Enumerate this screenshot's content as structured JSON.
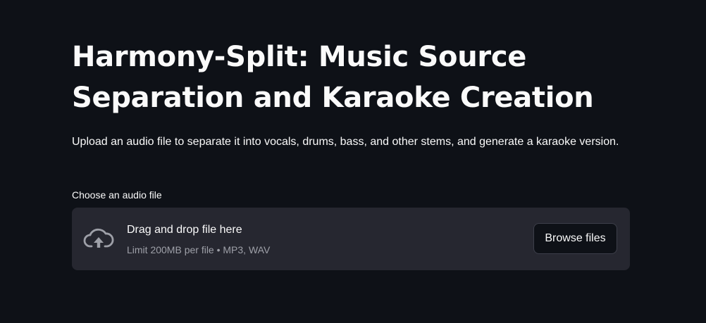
{
  "page": {
    "title": "Harmony-Split: Music Source Separation and Karaoke Creation",
    "description": "Upload an audio file to separate it into vocals, drums, bass, and other stems, and generate a karaoke version."
  },
  "uploader": {
    "label": "Choose an audio file",
    "instruction": "Drag and drop file here",
    "limit_text": "Limit 200MB per file • MP3, WAV",
    "browse_label": "Browse files",
    "icon": "cloud-upload-icon"
  },
  "colors": {
    "background": "#0e1117",
    "dropzone": "#262730",
    "text": "#fafafa",
    "muted_text": "#9ea0a8"
  }
}
